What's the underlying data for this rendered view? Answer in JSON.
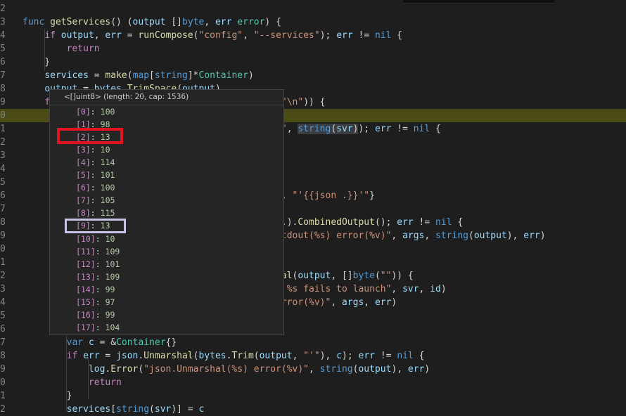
{
  "editor": {
    "lines": [
      {
        "num": "2",
        "html": ""
      },
      {
        "num": "3",
        "html": "<span class='kw'>func</span> <span class='fn'>getServices</span>() (<span class='var'>output</span> []<span class='kw'>byte</span>, <span class='var'>err</span> <span class='ty'>error</span>) {"
      },
      {
        "num": "4",
        "html": "    <span class='ctl'>if</span> <span class='var'>output</span>, <span class='var'>err</span> = <span class='fn'>runCompose</span>(<span class='str'>\"config\"</span>, <span class='str'>\"--services\"</span>); <span class='var'>err</span> != <span class='kw'>nil</span> {"
      },
      {
        "num": "5",
        "html": "        <span class='ctl'>return</span>"
      },
      {
        "num": "6",
        "html": "    }"
      },
      {
        "num": "7",
        "html": "    <span class='var'>services</span> = <span class='fn'>make</span>(<span class='kw'>map</span>[<span class='kw'>string</span>]*<span class='ty'>Container</span>)"
      },
      {
        "num": "8",
        "html": "    <span class='var'>output</span> = <span class='var'>bytes</span>.<span class='fn'>TrimSpace</span>(<span class='var'>output</span>)"
      },
      {
        "num": "9",
        "html": "    <span class='ctl'>f</span>                                       <span class='fn'>te</span>(<span class='str'>\"\\n\"</span>)) {"
      },
      {
        "num": "0",
        "html": "",
        "highlight": true
      },
      {
        "num": "1",
        "html": "                                            <span class='str'>'-q\"</span>, <span class='sel'><span class='kw'>string</span>(<span class='var'>svr</span>)</span>); <span class='var'>err</span> != <span class='kw'>nil</span> {"
      },
      {
        "num": "2",
        "html": ""
      },
      {
        "num": "3",
        "html": ""
      },
      {
        "num": "4",
        "html": ""
      },
      {
        "num": "5",
        "html": "                                           )"
      },
      {
        "num": "6",
        "html": "                                          <span class='str'>rmat\"</span>, <span class='str'>\"'{{json .}}'\"</span>}"
      },
      {
        "num": "7",
        "html": ""
      },
      {
        "num": "8",
        "html": "                                         <span class='var'>args</span>...).<span class='fn'>CombinedOutput</span>(); <span class='var'>err</span> != <span class='kw'>nil</span> {"
      },
      {
        "num": "9",
        "html": "                                         <span class='str'>(%v) stdout(%s) error(%v)\"</span>, <span class='var'>args</span>, <span class='kw'>string</span>(<span class='var'>output</span>), <span class='var'>err</span>)"
      },
      {
        "num": "0",
        "html": ""
      },
      {
        "num": "1",
        "html": ""
      },
      {
        "num": "2",
        "html": "                                         <span class='var'>es</span>.<span class='fn'>Equal</span>(<span class='var'>output</span>, []<span class='kw'>byte</span>(<span class='str'>\"\"</span>)) {"
      },
      {
        "num": "3",
        "html": "                                         <span class='str'>ainer: %s fails to launch\"</span>, <span class='var'>svr</span>, <span class='var'>id</span>)"
      },
      {
        "num": "4",
        "html": "                                         <span class='str'>(%v) error(%v)\"</span>, <span class='var'>args</span>, <span class='var'>err</span>)"
      },
      {
        "num": "5",
        "html": ""
      },
      {
        "num": "6",
        "html": ""
      },
      {
        "num": "7",
        "html": "        <span class='kw'>var</span> <span class='var'>c</span> = &amp;<span class='ty'>Container</span>{}"
      },
      {
        "num": "8",
        "html": "        <span class='ctl'>if</span> <span class='var'>err</span> = <span class='var'>json</span>.<span class='fn'>Unmarshal</span>(<span class='var'>bytes</span>.<span class='fn'>Trim</span>(<span class='var'>output</span>, <span class='str'>\"'\"</span>), <span class='var'>c</span>); <span class='var'>err</span> != <span class='kw'>nil</span> {"
      },
      {
        "num": "9",
        "html": "            <span class='var'>log</span>.<span class='fn'>Error</span>(<span class='str'>\"json.Unmarshal(%s) error(%v)\"</span>, <span class='kw'>string</span>(<span class='var'>output</span>), <span class='var'>err</span>)"
      },
      {
        "num": "0",
        "html": "            <span class='ctl'>return</span>"
      },
      {
        "num": "1",
        "html": "        }"
      },
      {
        "num": "2",
        "html": "        <span class='var'>services</span>[<span class='kw'>string</span>(<span class='var'>svr</span>)] = <span class='var'>c</span>"
      }
    ]
  },
  "hover": {
    "title": "<[]uint8> (length: 20, cap: 1536)",
    "items": [
      {
        "index": "[0]",
        "value": "100"
      },
      {
        "index": "[1]",
        "value": "98"
      },
      {
        "index": "[2]",
        "value": "13"
      },
      {
        "index": "[3]",
        "value": "10"
      },
      {
        "index": "[4]",
        "value": "114"
      },
      {
        "index": "[5]",
        "value": "101"
      },
      {
        "index": "[6]",
        "value": "100"
      },
      {
        "index": "[7]",
        "value": "105"
      },
      {
        "index": "[8]",
        "value": "115"
      },
      {
        "index": "[9]",
        "value": "13"
      },
      {
        "index": "[10]",
        "value": "10"
      },
      {
        "index": "[11]",
        "value": "109"
      },
      {
        "index": "[12]",
        "value": "101"
      },
      {
        "index": "[13]",
        "value": "109"
      },
      {
        "index": "[14]",
        "value": "99"
      },
      {
        "index": "[15]",
        "value": "97"
      },
      {
        "index": "[16]",
        "value": "99"
      },
      {
        "index": "[17]",
        "value": "104"
      }
    ]
  },
  "colors": {
    "background": "#1e1e1e",
    "highlight_line": "#4b4b18",
    "annotation_red": "#e0141e",
    "annotation_lavender": "#c8c2e6"
  }
}
